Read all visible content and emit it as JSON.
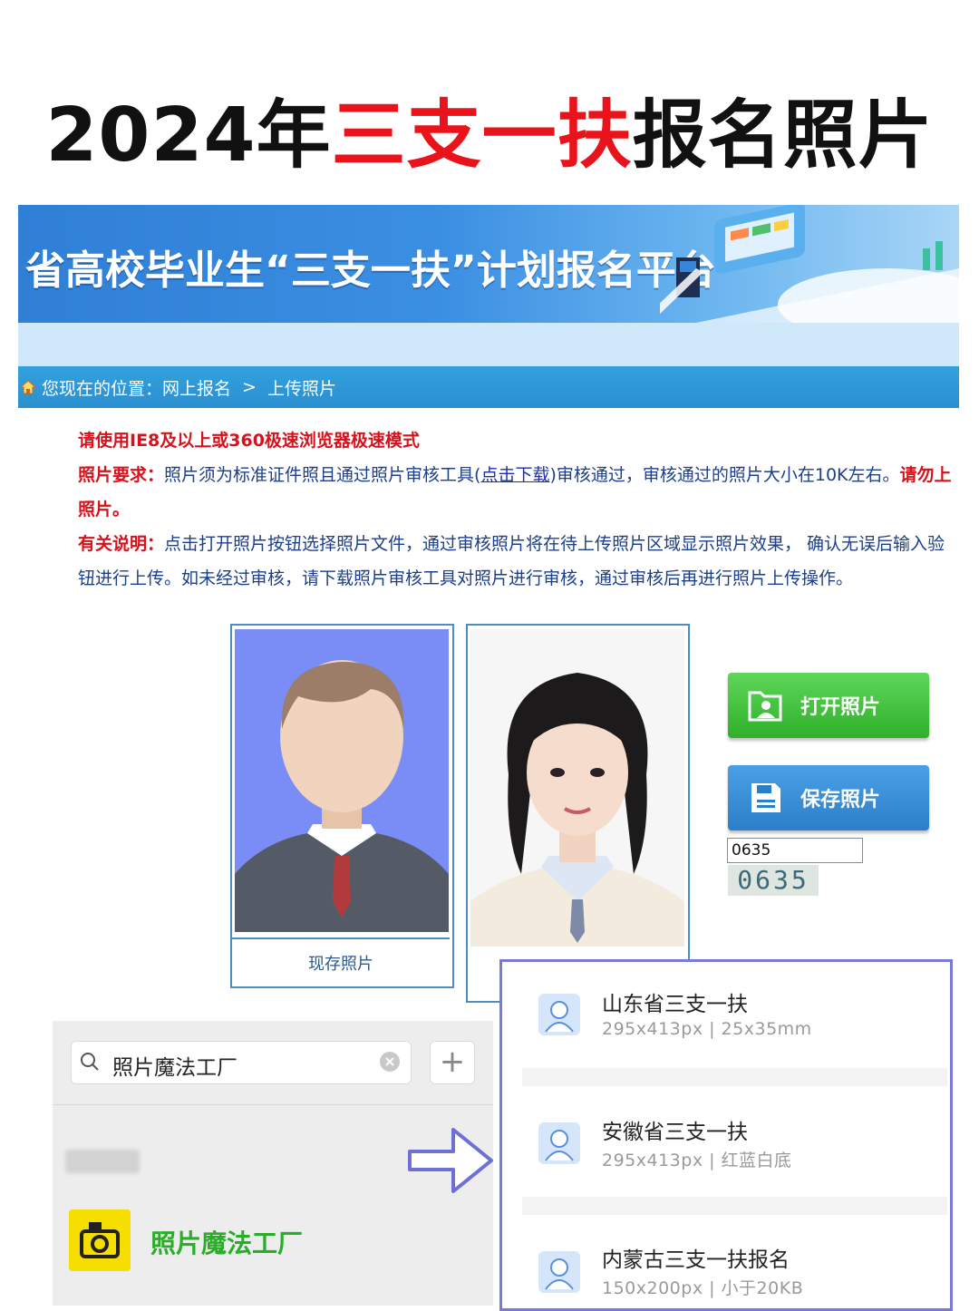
{
  "headline": {
    "prefix": "2024年",
    "highlight": "三支一扶",
    "suffix": "报名照片",
    "highlight_color": "#e8131b"
  },
  "banner": {
    "title": "省高校毕业生“三支一扶”计划报名平台"
  },
  "breadcrumb": {
    "label": "您现在的位置：",
    "item1": "网上报名",
    "separator": ">",
    "item2": "上传照片"
  },
  "notices": {
    "browser_tip": "请使用IE8及以上或360极速浏览器极速模式",
    "req_label": "照片要求：",
    "req_text1": "照片须为标准证件照且通过照片审核工具(",
    "req_link": "点击下载",
    "req_text2": ")审核通过，审核通过的照片大小在10K左右。",
    "req_warn": "请勿上",
    "req_line2": "照片。",
    "info_label": "有关说明：",
    "info_text1": "点击打开照片按钮选择照片文件，通过审核照片将在待上传照片区域显示照片效果， 确认无误后输入验",
    "info_text2": "钮进行上传。如未经过审核，请下载照片审核工具对照片进行审核，通过审核后再进行照片上传操作。"
  },
  "photos": {
    "existing_caption": "现存照片"
  },
  "actions": {
    "open_label": "打开照片",
    "save_label": "保存照片",
    "code_value": "0635",
    "captcha_text": "0635"
  },
  "wechat": {
    "search_value": "照片魔法工厂",
    "plus": "+",
    "result_name": "照片魔法工厂"
  },
  "mini_programs": [
    {
      "name": "山东省三支一扶",
      "spec": "295x413px | 25x35mm"
    },
    {
      "name": "安徽省三支一扶",
      "spec": "295x413px | 红蓝白底"
    },
    {
      "name": "内蒙古三支一扶报名",
      "spec": "150x200px | 小于20KB"
    }
  ],
  "colors": {
    "nav_blue": "#2b8fcf",
    "open_green": "#2fb02a",
    "save_blue": "#2b7fc9",
    "popup_border": "#7a79d8",
    "arrow": "#6f6fd8"
  }
}
